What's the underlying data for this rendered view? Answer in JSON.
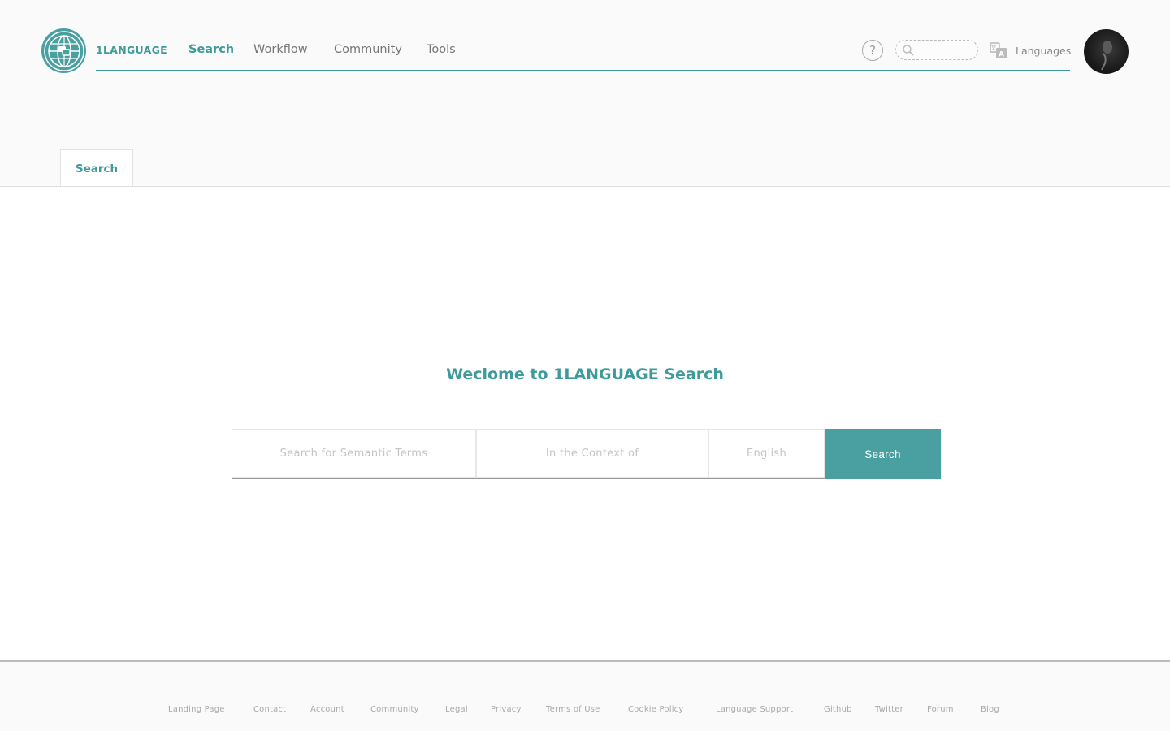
{
  "brand": "1LANGUAGE",
  "nav": {
    "search": "Search",
    "workflow": "Workflow",
    "community": "Community",
    "tools": "Tools"
  },
  "header": {
    "help_icon": "?",
    "search_placeholder": "",
    "languages_label": "Languages"
  },
  "tabs": {
    "search": "Search"
  },
  "main": {
    "welcome": "Weclome to 1LANGUAGE Search",
    "term_placeholder": "Search for Semantic Terms",
    "context_placeholder": "In the Context of",
    "language_value": "English",
    "search_button": "Search"
  },
  "footer": {
    "links": [
      "Landing Page",
      "Contact",
      "Account",
      "Community",
      "Legal",
      "Privacy",
      "Terms of Use",
      "Cookie Policy",
      "Language Support",
      "Github",
      "Twitter",
      "Forum",
      "Blog"
    ]
  },
  "colors": {
    "accent": "#3f9a9b",
    "button": "#4a9fa0"
  }
}
